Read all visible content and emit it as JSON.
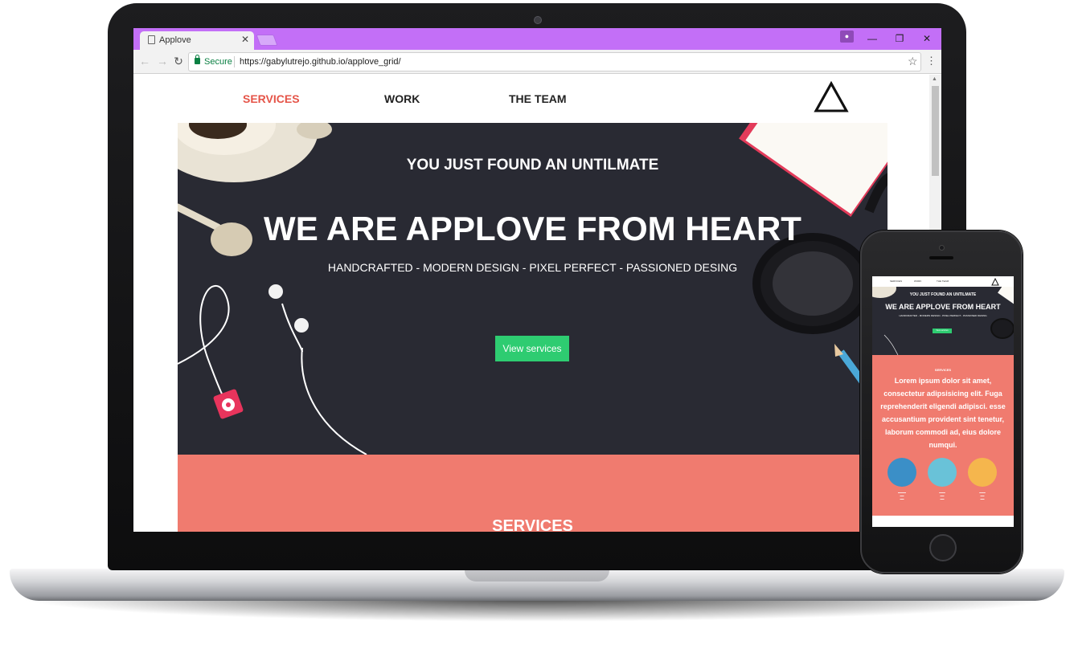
{
  "browser": {
    "tab_title": "Applove",
    "secure_label": "Secure",
    "url": "https://gabylutrejo.github.io/applove_grid/"
  },
  "site": {
    "nav": [
      "SERVICES",
      "WORK",
      "THE TEAM"
    ],
    "hero": {
      "kicker": "YOU JUST FOUND AN UNTILMATE",
      "title": "WE ARE APPLOVE FROM HEART",
      "tagline": "HANDCRAFTED - MODERN DESIGN - PIXEL PERFECT - PASSIONED DESING",
      "cta": "View services"
    },
    "services_title": "SERVICES"
  },
  "phone": {
    "services_label": "SERVICES",
    "lorem": "Lorem ipsum dolor sit amet, consectetur adipsisicing elit. Fuga reprehenderit eligendi adipisci. esse accusantium provident sint tenetur, laborum commodi ad, eius dolore numqui."
  },
  "colors": {
    "chrome_frame": "#c36ff7",
    "nav_active": "#e55448",
    "hero_bg": "#292a33",
    "cta": "#2ecc71",
    "services_bg": "#f07b6f"
  },
  "icons": [
    "page-icon",
    "close-icon",
    "lock-icon",
    "star-icon",
    "menu-icon",
    "back-icon",
    "forward-icon",
    "reload-icon",
    "triangle-logo-icon"
  ]
}
